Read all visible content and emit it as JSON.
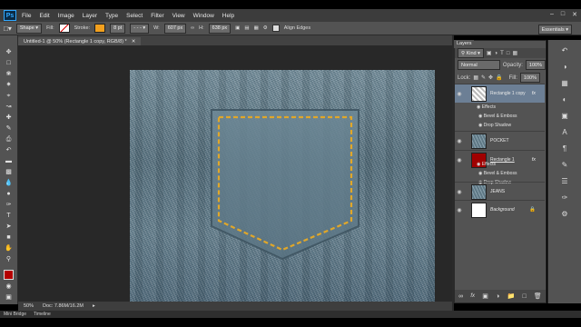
{
  "app": {
    "logo": "Ps"
  },
  "menu": [
    "File",
    "Edit",
    "Image",
    "Layer",
    "Type",
    "Select",
    "Filter",
    "View",
    "Window",
    "Help"
  ],
  "options": {
    "mode": "Shape",
    "fill_label": "Fill:",
    "stroke_label": "Stroke:",
    "stroke_width": "8 pt",
    "w_label": "W:",
    "w_value": "607 px",
    "h_label": "H:",
    "h_value": "638 px",
    "align_edges": "Align Edges",
    "workspace": "Essentials",
    "stroke_color": "#f2a01e"
  },
  "document": {
    "tab_title": "Untitled-1 @ 50% (Rectangle 1 copy, RGB/8) *",
    "zoom": "50%",
    "doc_size": "Doc: 7.86M/16.2M"
  },
  "bottom_tabs": [
    "Mini Bridge",
    "Timeline"
  ],
  "layers_panel": {
    "tab": "Layers",
    "kind": "Kind",
    "blend_mode": "Normal",
    "opacity_label": "Opacity:",
    "opacity_value": "100%",
    "lock_label": "Lock:",
    "fill_label": "Fill:",
    "fill_value": "100%",
    "layers": [
      {
        "name": "Rectangle 1 copy",
        "fx": "fx",
        "thumb": "dashed",
        "effects_label": "Effects",
        "effects": [
          "Bevel & Emboss",
          "Drop Shadow"
        ]
      },
      {
        "name": "POCKET",
        "fx": "",
        "thumb": "denim"
      },
      {
        "name": "Rectangle 1",
        "fx": "fx",
        "thumb": "red",
        "effects_label": "Effects",
        "effects": [
          "Bevel & Emboss",
          "Drop Shadow"
        ]
      },
      {
        "name": "JEANS",
        "fx": "",
        "thumb": "denim"
      },
      {
        "name": "Background",
        "fx": "",
        "thumb": "white"
      }
    ]
  },
  "colors": {
    "stitch": "#e0a72a",
    "foreground": "#b50000",
    "accent": "#31a8ff"
  }
}
